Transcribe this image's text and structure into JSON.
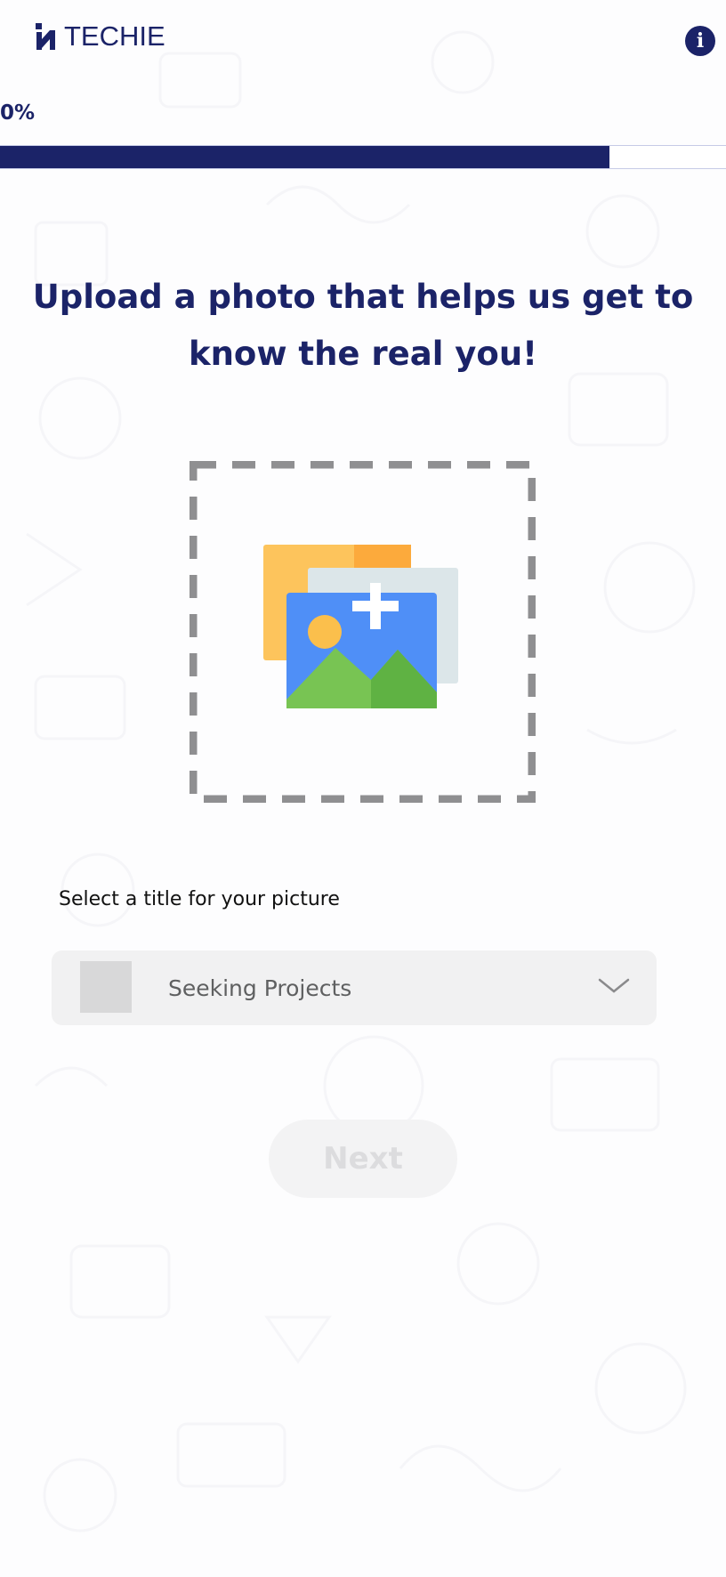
{
  "app": {
    "brand": "TECHIE",
    "info_icon": "info-circle-icon",
    "accent_color": "#1b2368"
  },
  "progress": {
    "label": "0%",
    "fill_fraction": 0.84
  },
  "main": {
    "headline": "Upload a photo that helps us get to know the real you!",
    "upload_icon": "add-photo-icon",
    "title_label": "Select a title for your picture",
    "title_select": {
      "value": "Seeking Projects",
      "chevron_icon": "chevron-down-icon"
    },
    "next_button": "Next"
  }
}
